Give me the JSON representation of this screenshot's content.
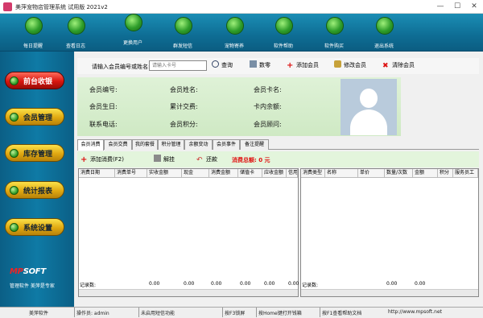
{
  "window": {
    "title": "美萍宠物店管理系统 试用版 2021v2",
    "minimize": "—",
    "maximize": "☐",
    "close": "✕"
  },
  "toolbar": [
    {
      "label": "每日提醒",
      "icon": "reminder-icon"
    },
    {
      "label": "查看日志",
      "icon": "log-icon"
    },
    {
      "label": "更换用户",
      "icon": "switch-user-icon"
    },
    {
      "label": "群发短信",
      "icon": "sms-icon"
    },
    {
      "label": "宠物寄养",
      "icon": "pet-boarding-icon"
    },
    {
      "label": "软件帮助",
      "icon": "help-icon"
    },
    {
      "label": "软件购买",
      "icon": "purchase-icon"
    },
    {
      "label": "退出系统",
      "icon": "exit-icon"
    }
  ],
  "sidebar": [
    {
      "label": "前台收银",
      "active": true
    },
    {
      "label": "会员管理"
    },
    {
      "label": "库存管理"
    },
    {
      "label": "统计报表"
    },
    {
      "label": "系统设置"
    }
  ],
  "brand": {
    "logo_mp": "MP",
    "logo_soft": "SOFT",
    "sub": "管理软件  美萍是专家"
  },
  "search": {
    "label": "请输入会员编号或姓名:",
    "placeholder": "请输入卡号",
    "query": "查询",
    "count": "数零",
    "add": "添加会员",
    "edit": "修改会员",
    "clear": "清除会员"
  },
  "member": {
    "id": "会员编号:",
    "name": "会员姓名:",
    "card": "会员卡名:",
    "birthday": "会员生日:",
    "total_spend": "累计交费:",
    "balance": "卡内余额:",
    "phone": "联系电话:",
    "points": "会员积分:",
    "advisor": "会员顾问:"
  },
  "tabs": [
    "会员消费",
    "会员交费",
    "我的套餐",
    "积分管理",
    "余额变动",
    "会员事件",
    "备注提醒"
  ],
  "actions": {
    "add_consume": "添加消费(F2)",
    "settle": "解挂",
    "repay": "还款",
    "total_label": "消费总额: 0 元"
  },
  "left_grid": {
    "headers": [
      "消费日期",
      "消费单号",
      "实收金额",
      "现金",
      "消费金额",
      "储值卡",
      "应收金额",
      "信用"
    ],
    "footer_label": "记录数:",
    "footer_values": [
      "0.00",
      "0.00",
      "0.00",
      "0.00",
      "0.00",
      "0.00"
    ]
  },
  "right_grid": {
    "headers": [
      "消费类型",
      "名称",
      "单价",
      "数量/次数",
      "金额",
      "积分",
      "服务员工"
    ],
    "footer_label": "记录数:",
    "footer_values": [
      "0.00",
      "0.00"
    ]
  },
  "status": {
    "company": "美萍软件",
    "operator": "操作员: admin",
    "sms": "未启用短信功能",
    "f3": "按F3锁屏",
    "home": "按Home键打开钱箱",
    "f1": "按F1查看帮助文档",
    "url": "http://www.mpsoft.net"
  },
  "colors": {
    "toolbar_bg": "#0e6d94",
    "sidebar_bg": "#0b5f86",
    "active_btn": "#d8160f",
    "button": "#e0a811",
    "info_bg": "#d6edcc",
    "total_text": "#e01010"
  }
}
